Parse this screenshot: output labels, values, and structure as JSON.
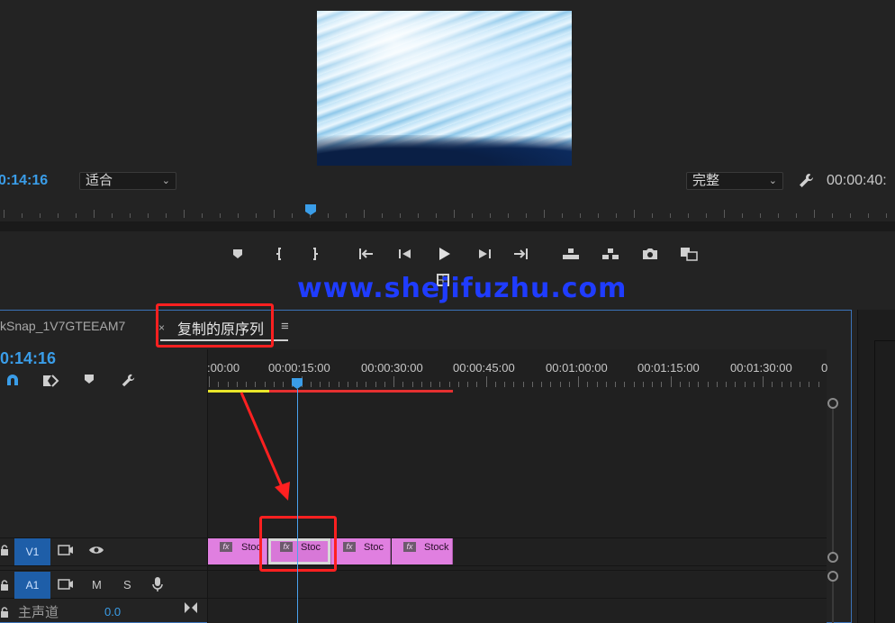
{
  "monitor": {
    "current_time": "0:14:16",
    "fit_dropdown": "适合",
    "quality_dropdown": "完整",
    "duration_time": "00:00:40:",
    "watermark": "www.shejifuzhu.com"
  },
  "transport_buttons": [
    "add-marker",
    "mark-in",
    "mark-out",
    "go-to-in",
    "step-back",
    "play",
    "step-forward",
    "go-to-out",
    "lift",
    "extract",
    "export-frame",
    "comparison-view"
  ],
  "timeline": {
    "tab_inactive": "kSnap_1V7GTEEAM7",
    "tab_close": "×",
    "tab_active": "复制的原序列",
    "tab_menu": "≡",
    "current_time": "0:14:16",
    "ruler_labels": [
      ":00:00",
      "00:00:15:00",
      "00:00:30:00",
      "00:00:45:00",
      "00:01:00:00",
      "00:01:15:00",
      "00:01:30:00",
      "0"
    ],
    "tracks": {
      "video": {
        "label": "V1"
      },
      "audio": {
        "label": "A1",
        "mute": "M",
        "solo": "S"
      },
      "master": {
        "label": "主声道",
        "value": "0.0"
      }
    },
    "clips": [
      {
        "name": "Stoc",
        "fx": "fx",
        "selected": false
      },
      {
        "name": "Stoc",
        "fx": "fx",
        "selected": true
      },
      {
        "name": "Stoc",
        "fx": "fx",
        "selected": false
      },
      {
        "name": "Stock",
        "fx": "fx",
        "selected": false
      }
    ]
  },
  "colors": {
    "timecode_blue": "#3a9de8",
    "clip_pink": "#e07fe0",
    "annotation_red": "#ff2020",
    "watermark_blue": "#1f3cff",
    "track_label_blue": "#1e5ea8"
  }
}
